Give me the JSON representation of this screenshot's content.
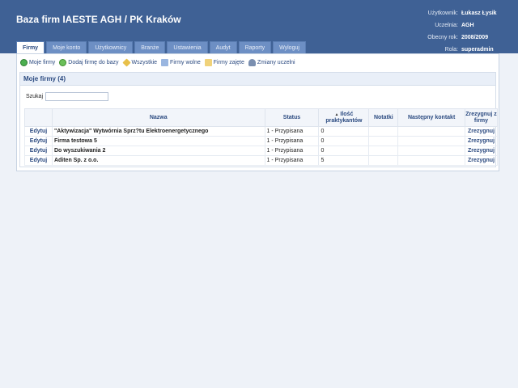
{
  "app": {
    "title": "Baza firm IAESTE AGH / PK Kraków"
  },
  "user": {
    "rows": [
      {
        "label": "Użytkownik:",
        "value": "Łukasz Łysik"
      },
      {
        "label": "Uczelnia:",
        "value": "AGH"
      },
      {
        "label": "Obecny rok:",
        "value": "2008/2009"
      },
      {
        "label": "Rola:",
        "value": "superadmin"
      }
    ]
  },
  "tabs": [
    "Firmy",
    "Moje konto",
    "Użytkownicy",
    "Branże",
    "Ustawienia",
    "Audyt",
    "Raporty",
    "Wyloguj"
  ],
  "toolbar": {
    "items": [
      "Moje firmy",
      "Dodaj firmę do bazy",
      "Wszystkie",
      "Firmy wolne",
      "Firmy zajęte",
      "Zmiany uczelni"
    ]
  },
  "section": {
    "title": "Moje firmy (4)"
  },
  "search": {
    "label": "Szukaj",
    "value": ""
  },
  "table": {
    "headers": [
      "",
      "Nazwa",
      "Status",
      "Ilość praktykantów",
      "Notatki",
      "Następny kontakt",
      "Zrezygnuj z firmy"
    ],
    "rows": [
      {
        "edit": "Edytuj",
        "name": "\"Aktywizacja\" Wytwórnia Sprz?tu Elektroenergetycznego",
        "status": "1 - Przypisana",
        "count": "0",
        "notes": "",
        "next": "",
        "resign": "Zrezygnuj"
      },
      {
        "edit": "Edytuj",
        "name": "Firma testowa 5",
        "status": "1 - Przypisana",
        "count": "0",
        "notes": "",
        "next": "",
        "resign": "Zrezygnuj"
      },
      {
        "edit": "Edytuj",
        "name": "Do wyszukiwania 2",
        "status": "1 - Przypisana",
        "count": "0",
        "notes": "",
        "next": "",
        "resign": "Zrezygnuj"
      },
      {
        "edit": "Edytuj",
        "name": "Aditen Sp. z o.o.",
        "status": "1 - Przypisana",
        "count": "5",
        "notes": "",
        "next": "",
        "resign": "Zrezygnuj"
      }
    ]
  }
}
